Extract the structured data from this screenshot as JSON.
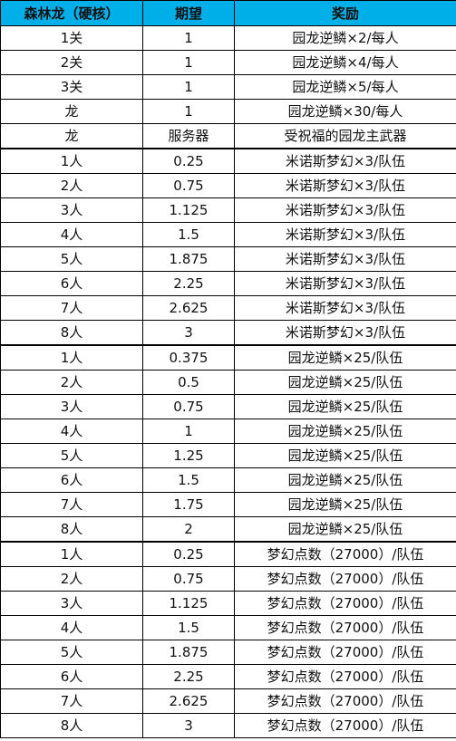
{
  "header": {
    "col1": "森林龙（硬核）",
    "col2": "期望",
    "col3": "奖励"
  },
  "rows": [
    {
      "a": "1关",
      "b": "1",
      "c": "园龙逆鳞×2/每人"
    },
    {
      "a": "2关",
      "b": "1",
      "c": "园龙逆鳞×4/每人"
    },
    {
      "a": "3关",
      "b": "1",
      "c": "园龙逆鳞×5/每人"
    },
    {
      "a": "龙",
      "b": "1",
      "c": "园龙逆鳞×30/每人"
    },
    {
      "a": "龙",
      "b": "服务器",
      "c": "受祝福的园龙主武器"
    },
    {
      "a": "1人",
      "b": "0.25",
      "c": "米诺斯梦幻×3/队伍",
      "group_start": true
    },
    {
      "a": "2人",
      "b": "0.75",
      "c": "米诺斯梦幻×3/队伍"
    },
    {
      "a": "3人",
      "b": "1.125",
      "c": "米诺斯梦幻×3/队伍"
    },
    {
      "a": "4人",
      "b": "1.5",
      "c": "米诺斯梦幻×3/队伍"
    },
    {
      "a": "5人",
      "b": "1.875",
      "c": "米诺斯梦幻×3/队伍"
    },
    {
      "a": "6人",
      "b": "2.25",
      "c": "米诺斯梦幻×3/队伍"
    },
    {
      "a": "7人",
      "b": "2.625",
      "c": "米诺斯梦幻×3/队伍"
    },
    {
      "a": "8人",
      "b": "3",
      "c": "米诺斯梦幻×3/队伍"
    },
    {
      "a": "1人",
      "b": "0.375",
      "c": "园龙逆鳞×25/队伍",
      "group_start": true
    },
    {
      "a": "2人",
      "b": "0.5",
      "c": "园龙逆鳞×25/队伍"
    },
    {
      "a": "3人",
      "b": "0.75",
      "c": "园龙逆鳞×25/队伍"
    },
    {
      "a": "4人",
      "b": "1",
      "c": "园龙逆鳞×25/队伍"
    },
    {
      "a": "5人",
      "b": "1.25",
      "c": "园龙逆鳞×25/队伍"
    },
    {
      "a": "6人",
      "b": "1.5",
      "c": "园龙逆鳞×25/队伍"
    },
    {
      "a": "7人",
      "b": "1.75",
      "c": "园龙逆鳞×25/队伍"
    },
    {
      "a": "8人",
      "b": "2",
      "c": "园龙逆鳞×25/队伍"
    },
    {
      "a": "1人",
      "b": "0.25",
      "c": "梦幻点数（27000）/队伍",
      "group_start": true
    },
    {
      "a": "2人",
      "b": "0.75",
      "c": "梦幻点数（27000）/队伍"
    },
    {
      "a": "3人",
      "b": "1.125",
      "c": "梦幻点数（27000）/队伍"
    },
    {
      "a": "4人",
      "b": "1.5",
      "c": "梦幻点数（27000）/队伍"
    },
    {
      "a": "5人",
      "b": "1.875",
      "c": "梦幻点数（27000）/队伍"
    },
    {
      "a": "6人",
      "b": "2.25",
      "c": "梦幻点数（27000）/队伍"
    },
    {
      "a": "7人",
      "b": "2.625",
      "c": "梦幻点数（27000）/队伍"
    },
    {
      "a": "8人",
      "b": "3",
      "c": "梦幻点数（27000）/队伍"
    }
  ]
}
